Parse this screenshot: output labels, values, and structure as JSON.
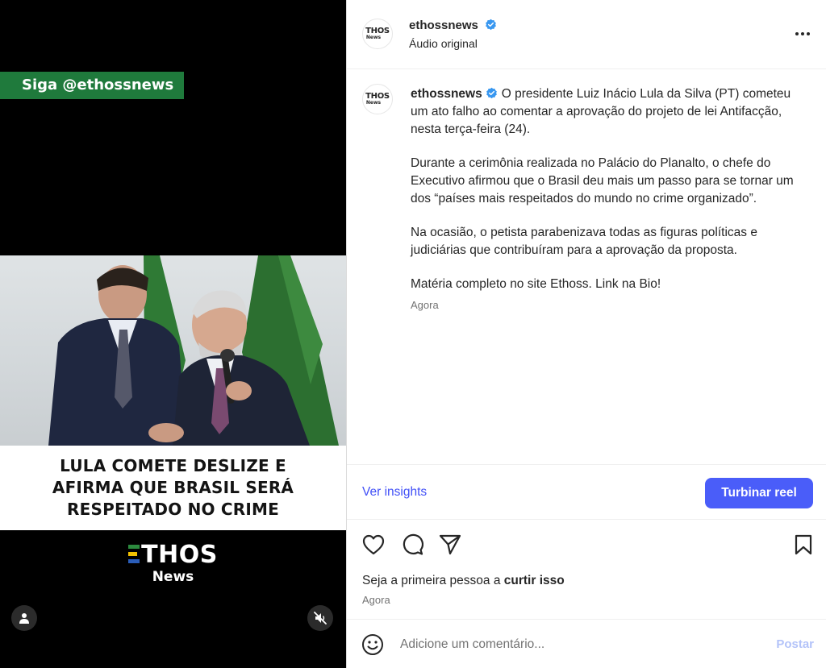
{
  "video": {
    "follow_banner": "Siga @ethossnews",
    "caption_lines": [
      "LULA COMETE DESLIZE E",
      "AFIRMA QUE BRASIL SERÁ",
      "RESPEITADO NO CRIME"
    ],
    "logo_main": "THOS",
    "logo_sub": "News",
    "user_tag_icon": "user-icon",
    "mute_icon": "speaker-muted-icon"
  },
  "header": {
    "avatar_main": "THOS",
    "avatar_sub": "News",
    "username": "ethossnews",
    "audio": "Áudio original",
    "more_icon": "more-horizontal-icon"
  },
  "caption": {
    "username": "ethossnews",
    "paragraphs": [
      "O presidente Luiz Inácio Lula da Silva (PT) cometeu um ato falho ao comentar a aprovação do projeto de lei Antifacção, nesta terça-feira (24).",
      "Durante a cerimônia realizada no Palácio do Planalto, o chefe do Executivo afirmou que o Brasil deu mais um passo para se tornar um dos “países mais respeitados do mundo no crime organizado”.",
      "Na ocasião, o petista parabenizava todas as figuras políticas e judiciárias que contribuíram para a aprovação da proposta.",
      "Matéria completo no site Ethoss. Link na Bio!"
    ],
    "timestamp": "Agora"
  },
  "insights": {
    "link": "Ver insights",
    "boost": "Turbinar reel"
  },
  "likes": {
    "prefix": "Seja a primeira pessoa a ",
    "action": "curtir isso",
    "timestamp": "Agora"
  },
  "comment": {
    "placeholder": "Adicione um comentário...",
    "post": "Postar"
  },
  "colors": {
    "accent": "#4a5df9",
    "link": "#4150f7",
    "banner_green": "#1f7a3c",
    "verified": "#3897f0"
  }
}
